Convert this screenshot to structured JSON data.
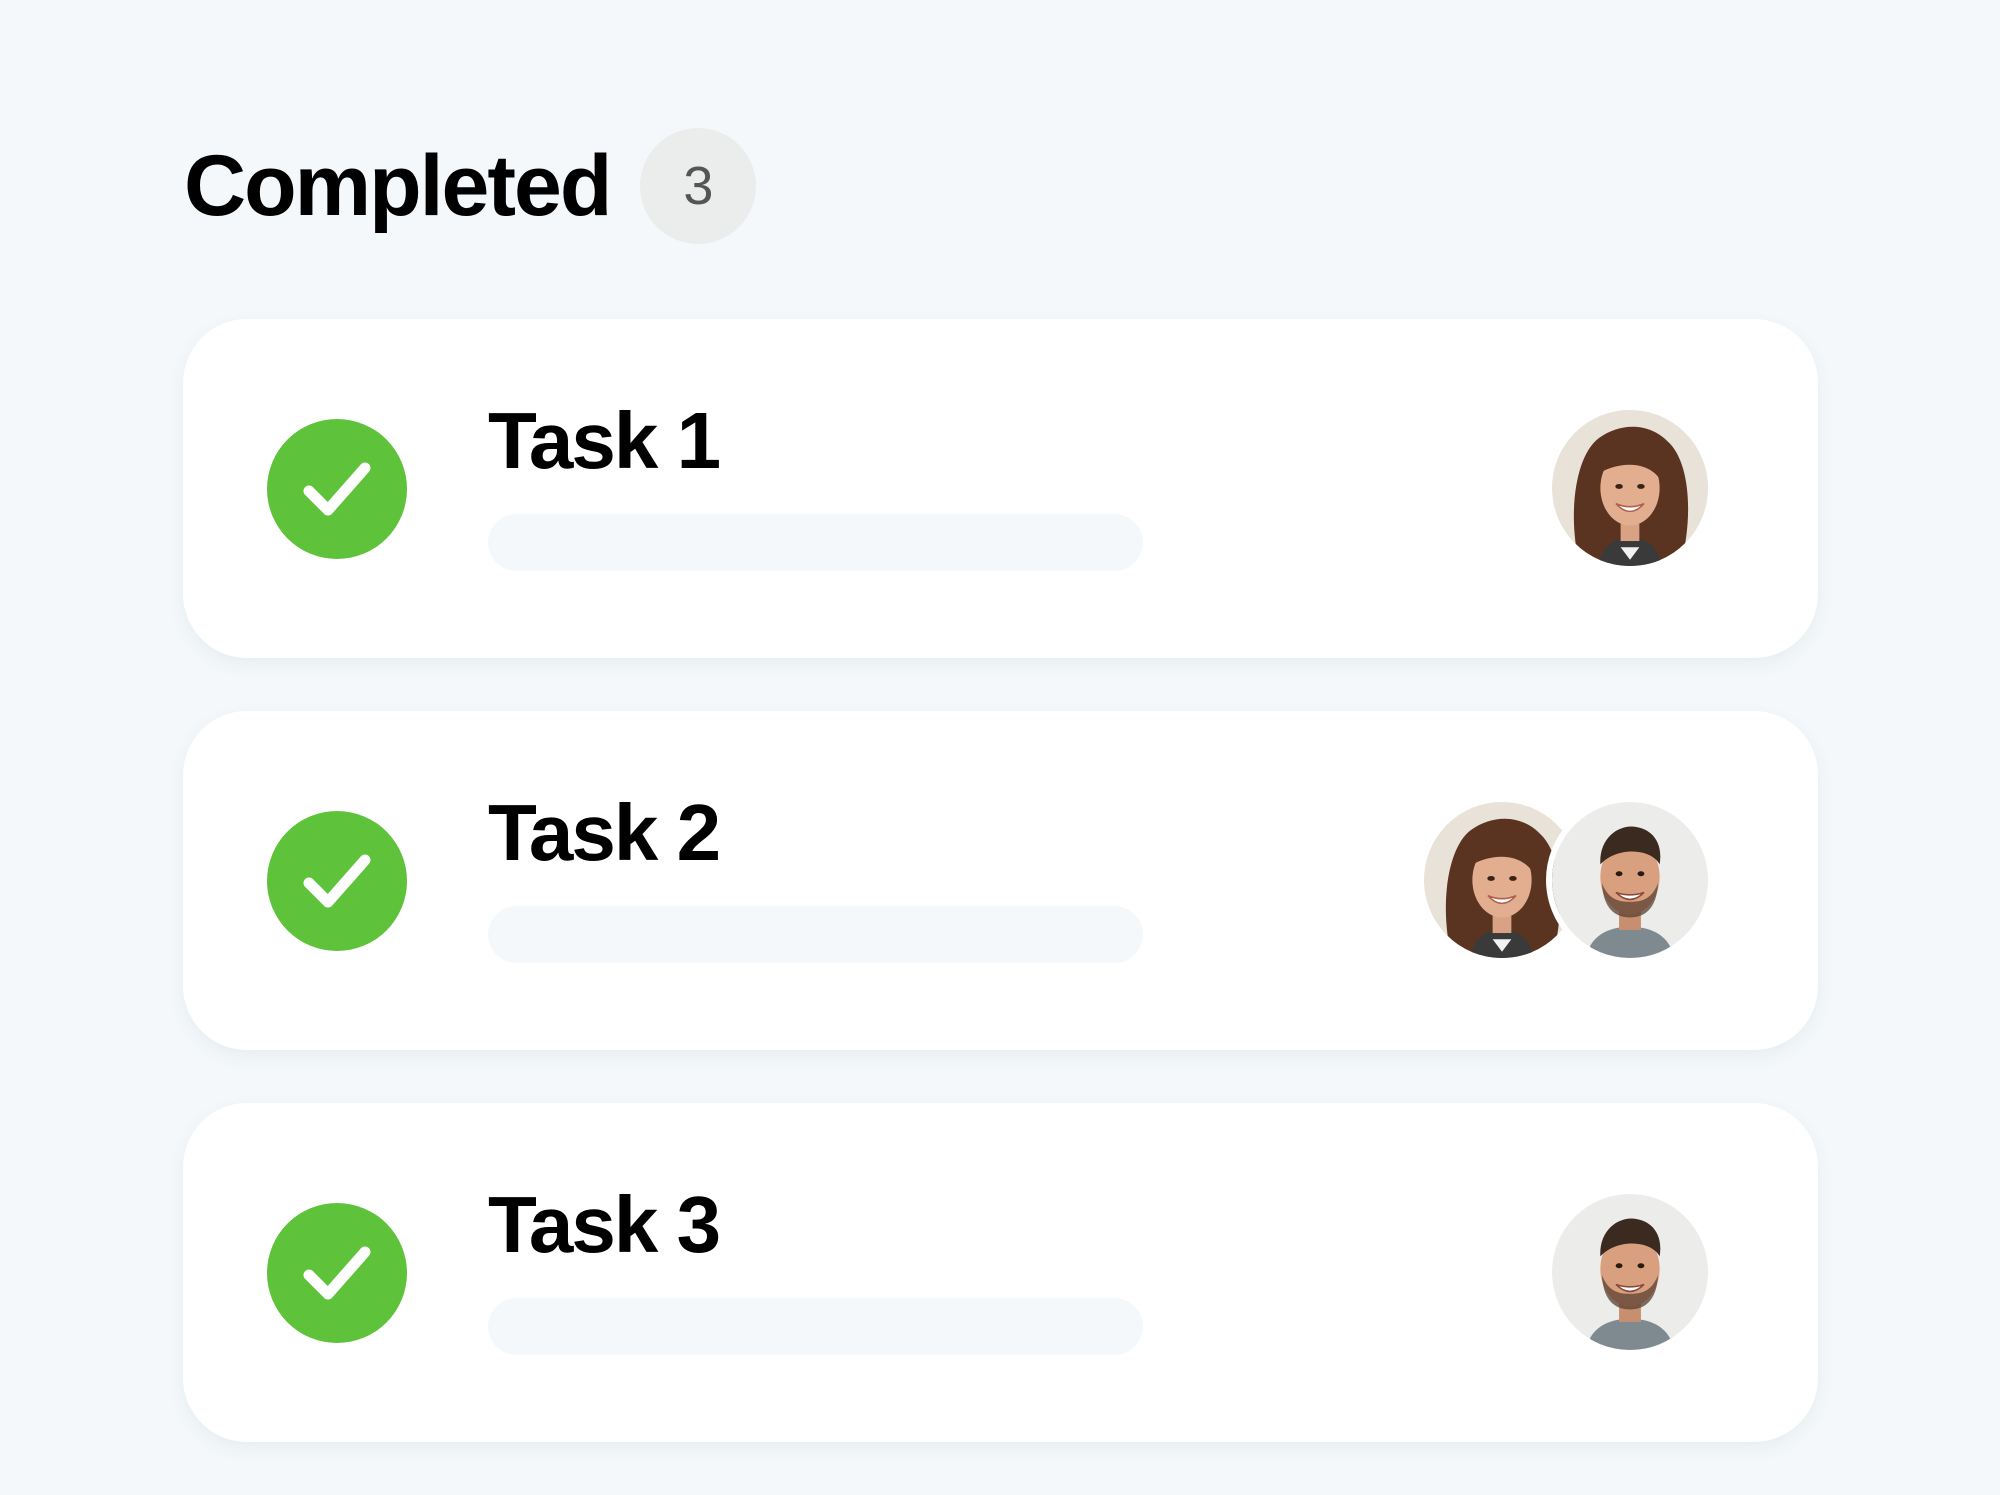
{
  "section": {
    "title": "Completed",
    "count": "3"
  },
  "colors": {
    "page_background": "#F4F8FA",
    "card_background": "#FFFFFF",
    "complete_green": "#5EC23A",
    "badge_background": "#EBEDED"
  },
  "tasks": [
    {
      "title": "Task 1",
      "status_icon": "check-circle-icon",
      "assignees": [
        "woman-curly-hair-avatar"
      ]
    },
    {
      "title": "Task 2",
      "status_icon": "check-circle-icon",
      "assignees": [
        "woman-curly-hair-avatar",
        "man-beard-avatar"
      ]
    },
    {
      "title": "Task 3",
      "status_icon": "check-circle-icon",
      "assignees": [
        "man-beard-avatar"
      ]
    }
  ]
}
